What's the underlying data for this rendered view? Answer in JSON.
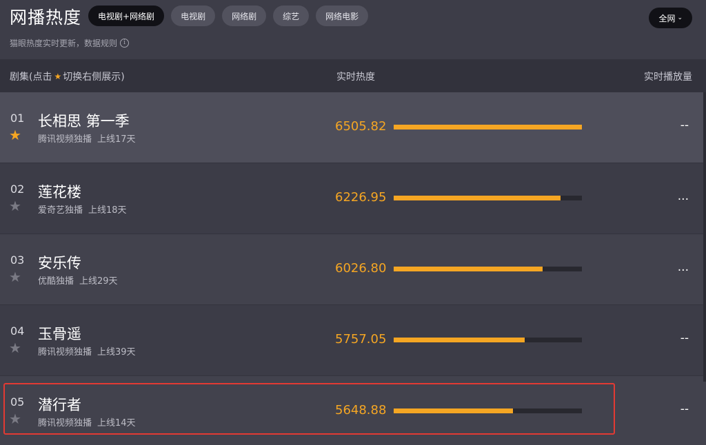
{
  "header": {
    "title": "网播热度",
    "tabs": [
      {
        "label": "电视剧+网络剧",
        "active": true
      },
      {
        "label": "电视剧",
        "active": false
      },
      {
        "label": "网络剧",
        "active": false
      },
      {
        "label": "综艺",
        "active": false
      },
      {
        "label": "网络电影",
        "active": false
      }
    ],
    "scope_label": "全网",
    "subtitle": "猫眼热度实时更新，数据规则",
    "info_glyph": "i"
  },
  "table": {
    "headers": {
      "name_prefix": "剧集(点击",
      "name_suffix": "切换右侧展示)",
      "heat": "实时热度",
      "play": "实时播放量"
    },
    "rows": [
      {
        "rank": "01",
        "title": "长相思 第一季",
        "platform": "腾讯视频独播",
        "online": "上线17天",
        "heat": "6505.82",
        "heat_fraction": 1.0,
        "play": "--",
        "starred": true
      },
      {
        "rank": "02",
        "title": "莲花楼",
        "platform": "爱奇艺独播",
        "online": "上线18天",
        "heat": "6226.95",
        "heat_fraction": 0.887,
        "play": "...",
        "starred": false
      },
      {
        "rank": "03",
        "title": "安乐传",
        "platform": "优酷独播",
        "online": "上线29天",
        "heat": "6026.80",
        "heat_fraction": 0.791,
        "play": "...",
        "starred": false
      },
      {
        "rank": "04",
        "title": "玉骨遥",
        "platform": "腾讯视频独播",
        "online": "上线39天",
        "heat": "5757.05",
        "heat_fraction": 0.696,
        "play": "--",
        "starred": false
      },
      {
        "rank": "05",
        "title": "潜行者",
        "platform": "腾讯视频独播",
        "online": "上线14天",
        "heat": "5648.88",
        "heat_fraction": 0.633,
        "play": "--",
        "starred": false
      }
    ]
  },
  "colors": {
    "accent": "#f5a623",
    "highlight_border": "#e33a33"
  }
}
